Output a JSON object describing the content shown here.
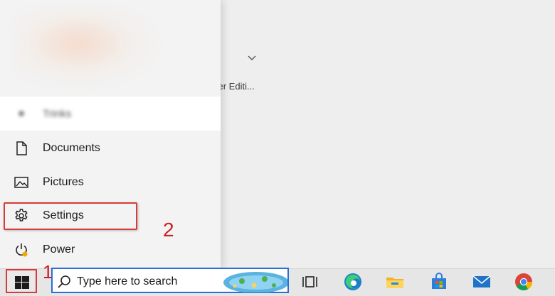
{
  "background": {
    "truncated_text": "cer Editi..."
  },
  "start_menu": {
    "blurred_item_label": "Trinks",
    "items": [
      {
        "label": "Documents",
        "icon": "document-icon"
      },
      {
        "label": "Pictures",
        "icon": "pictures-icon"
      },
      {
        "label": "Settings",
        "icon": "gear-icon"
      },
      {
        "label": "Power",
        "icon": "power-icon"
      }
    ]
  },
  "annotations": {
    "step1": "1",
    "step2": "2",
    "color": "#d93a3a"
  },
  "taskbar": {
    "search_placeholder": "Type here to search",
    "pinned": [
      "task-view-icon",
      "edge-icon",
      "file-explorer-icon",
      "microsoft-store-icon",
      "mail-icon",
      "chrome-icon"
    ],
    "search_border_color": "#2b6fd6"
  }
}
